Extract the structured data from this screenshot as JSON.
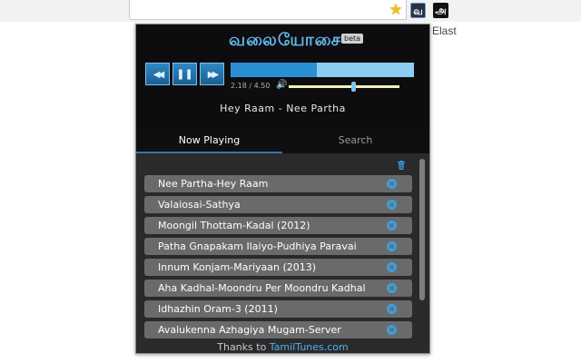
{
  "browser": {
    "background_text": "Elast",
    "ext_icons": [
      "வ",
      "அ"
    ]
  },
  "player": {
    "logo": "வலையோசை",
    "beta": "beta",
    "time": "2.18 / 4.50",
    "progress": 0.47,
    "volume": 0.58,
    "now_playing": "Hey Raam - Nee Partha",
    "controls": {
      "prev": "◀◀",
      "pause": "❚❚",
      "next": "▶▶"
    }
  },
  "tabs": [
    {
      "label": "Now Playing"
    },
    {
      "label": "Search"
    }
  ],
  "playlist": {
    "items": [
      "Nee Partha-Hey Raam",
      "Valaiosai-Sathya",
      "Moongil Thottam-Kadal (2012)",
      "Patha Gnapakam Ilaiyo-Pudhiya Paravai",
      "Innum Konjam-Mariyaan (2013)",
      "Aha Kadhal-Moondru Per Moondru Kadhal",
      "Idhazhin Oram-3 (2011)",
      "Avalukenna Azhagiya Mugam-Server"
    ]
  },
  "footer": {
    "text": "Thanks to ",
    "link": "TamilTunes.com"
  },
  "colors": {
    "accent": "#2b8fd3",
    "remove_icon": "#3aa0e0"
  }
}
